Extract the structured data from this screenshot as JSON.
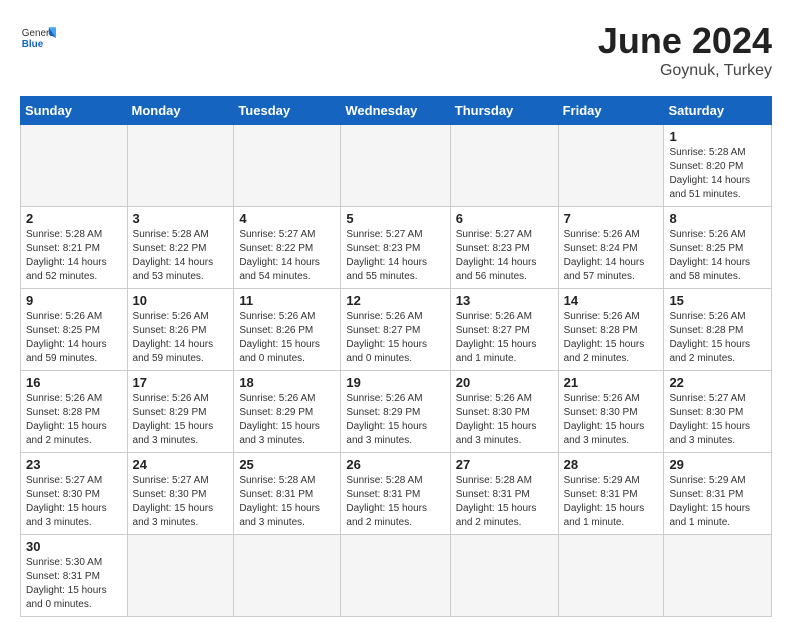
{
  "header": {
    "logo_general": "General",
    "logo_blue": "Blue",
    "month_title": "June 2024",
    "location": "Goynuk, Turkey"
  },
  "days_of_week": [
    "Sunday",
    "Monday",
    "Tuesday",
    "Wednesday",
    "Thursday",
    "Friday",
    "Saturday"
  ],
  "weeks": [
    [
      {
        "day": "",
        "info": "",
        "empty": true
      },
      {
        "day": "",
        "info": "",
        "empty": true
      },
      {
        "day": "",
        "info": "",
        "empty": true
      },
      {
        "day": "",
        "info": "",
        "empty": true
      },
      {
        "day": "",
        "info": "",
        "empty": true
      },
      {
        "day": "",
        "info": "",
        "empty": true
      },
      {
        "day": "1",
        "info": "Sunrise: 5:28 AM\nSunset: 8:20 PM\nDaylight: 14 hours\nand 51 minutes.",
        "empty": false
      }
    ],
    [
      {
        "day": "2",
        "info": "Sunrise: 5:28 AM\nSunset: 8:21 PM\nDaylight: 14 hours\nand 52 minutes.",
        "empty": false
      },
      {
        "day": "3",
        "info": "Sunrise: 5:28 AM\nSunset: 8:22 PM\nDaylight: 14 hours\nand 53 minutes.",
        "empty": false
      },
      {
        "day": "4",
        "info": "Sunrise: 5:27 AM\nSunset: 8:22 PM\nDaylight: 14 hours\nand 54 minutes.",
        "empty": false
      },
      {
        "day": "5",
        "info": "Sunrise: 5:27 AM\nSunset: 8:23 PM\nDaylight: 14 hours\nand 55 minutes.",
        "empty": false
      },
      {
        "day": "6",
        "info": "Sunrise: 5:27 AM\nSunset: 8:23 PM\nDaylight: 14 hours\nand 56 minutes.",
        "empty": false
      },
      {
        "day": "7",
        "info": "Sunrise: 5:26 AM\nSunset: 8:24 PM\nDaylight: 14 hours\nand 57 minutes.",
        "empty": false
      },
      {
        "day": "8",
        "info": "Sunrise: 5:26 AM\nSunset: 8:25 PM\nDaylight: 14 hours\nand 58 minutes.",
        "empty": false
      }
    ],
    [
      {
        "day": "9",
        "info": "Sunrise: 5:26 AM\nSunset: 8:25 PM\nDaylight: 14 hours\nand 59 minutes.",
        "empty": false
      },
      {
        "day": "10",
        "info": "Sunrise: 5:26 AM\nSunset: 8:26 PM\nDaylight: 14 hours\nand 59 minutes.",
        "empty": false
      },
      {
        "day": "11",
        "info": "Sunrise: 5:26 AM\nSunset: 8:26 PM\nDaylight: 15 hours\nand 0 minutes.",
        "empty": false
      },
      {
        "day": "12",
        "info": "Sunrise: 5:26 AM\nSunset: 8:27 PM\nDaylight: 15 hours\nand 0 minutes.",
        "empty": false
      },
      {
        "day": "13",
        "info": "Sunrise: 5:26 AM\nSunset: 8:27 PM\nDaylight: 15 hours\nand 1 minute.",
        "empty": false
      },
      {
        "day": "14",
        "info": "Sunrise: 5:26 AM\nSunset: 8:28 PM\nDaylight: 15 hours\nand 2 minutes.",
        "empty": false
      },
      {
        "day": "15",
        "info": "Sunrise: 5:26 AM\nSunset: 8:28 PM\nDaylight: 15 hours\nand 2 minutes.",
        "empty": false
      }
    ],
    [
      {
        "day": "16",
        "info": "Sunrise: 5:26 AM\nSunset: 8:28 PM\nDaylight: 15 hours\nand 2 minutes.",
        "empty": false
      },
      {
        "day": "17",
        "info": "Sunrise: 5:26 AM\nSunset: 8:29 PM\nDaylight: 15 hours\nand 3 minutes.",
        "empty": false
      },
      {
        "day": "18",
        "info": "Sunrise: 5:26 AM\nSunset: 8:29 PM\nDaylight: 15 hours\nand 3 minutes.",
        "empty": false
      },
      {
        "day": "19",
        "info": "Sunrise: 5:26 AM\nSunset: 8:29 PM\nDaylight: 15 hours\nand 3 minutes.",
        "empty": false
      },
      {
        "day": "20",
        "info": "Sunrise: 5:26 AM\nSunset: 8:30 PM\nDaylight: 15 hours\nand 3 minutes.",
        "empty": false
      },
      {
        "day": "21",
        "info": "Sunrise: 5:26 AM\nSunset: 8:30 PM\nDaylight: 15 hours\nand 3 minutes.",
        "empty": false
      },
      {
        "day": "22",
        "info": "Sunrise: 5:27 AM\nSunset: 8:30 PM\nDaylight: 15 hours\nand 3 minutes.",
        "empty": false
      }
    ],
    [
      {
        "day": "23",
        "info": "Sunrise: 5:27 AM\nSunset: 8:30 PM\nDaylight: 15 hours\nand 3 minutes.",
        "empty": false
      },
      {
        "day": "24",
        "info": "Sunrise: 5:27 AM\nSunset: 8:30 PM\nDaylight: 15 hours\nand 3 minutes.",
        "empty": false
      },
      {
        "day": "25",
        "info": "Sunrise: 5:28 AM\nSunset: 8:31 PM\nDaylight: 15 hours\nand 3 minutes.",
        "empty": false
      },
      {
        "day": "26",
        "info": "Sunrise: 5:28 AM\nSunset: 8:31 PM\nDaylight: 15 hours\nand 2 minutes.",
        "empty": false
      },
      {
        "day": "27",
        "info": "Sunrise: 5:28 AM\nSunset: 8:31 PM\nDaylight: 15 hours\nand 2 minutes.",
        "empty": false
      },
      {
        "day": "28",
        "info": "Sunrise: 5:29 AM\nSunset: 8:31 PM\nDaylight: 15 hours\nand 1 minute.",
        "empty": false
      },
      {
        "day": "29",
        "info": "Sunrise: 5:29 AM\nSunset: 8:31 PM\nDaylight: 15 hours\nand 1 minute.",
        "empty": false
      }
    ],
    [
      {
        "day": "30",
        "info": "Sunrise: 5:30 AM\nSunset: 8:31 PM\nDaylight: 15 hours\nand 0 minutes.",
        "empty": false
      },
      {
        "day": "",
        "info": "",
        "empty": true
      },
      {
        "day": "",
        "info": "",
        "empty": true
      },
      {
        "day": "",
        "info": "",
        "empty": true
      },
      {
        "day": "",
        "info": "",
        "empty": true
      },
      {
        "day": "",
        "info": "",
        "empty": true
      },
      {
        "day": "",
        "info": "",
        "empty": true
      }
    ]
  ]
}
